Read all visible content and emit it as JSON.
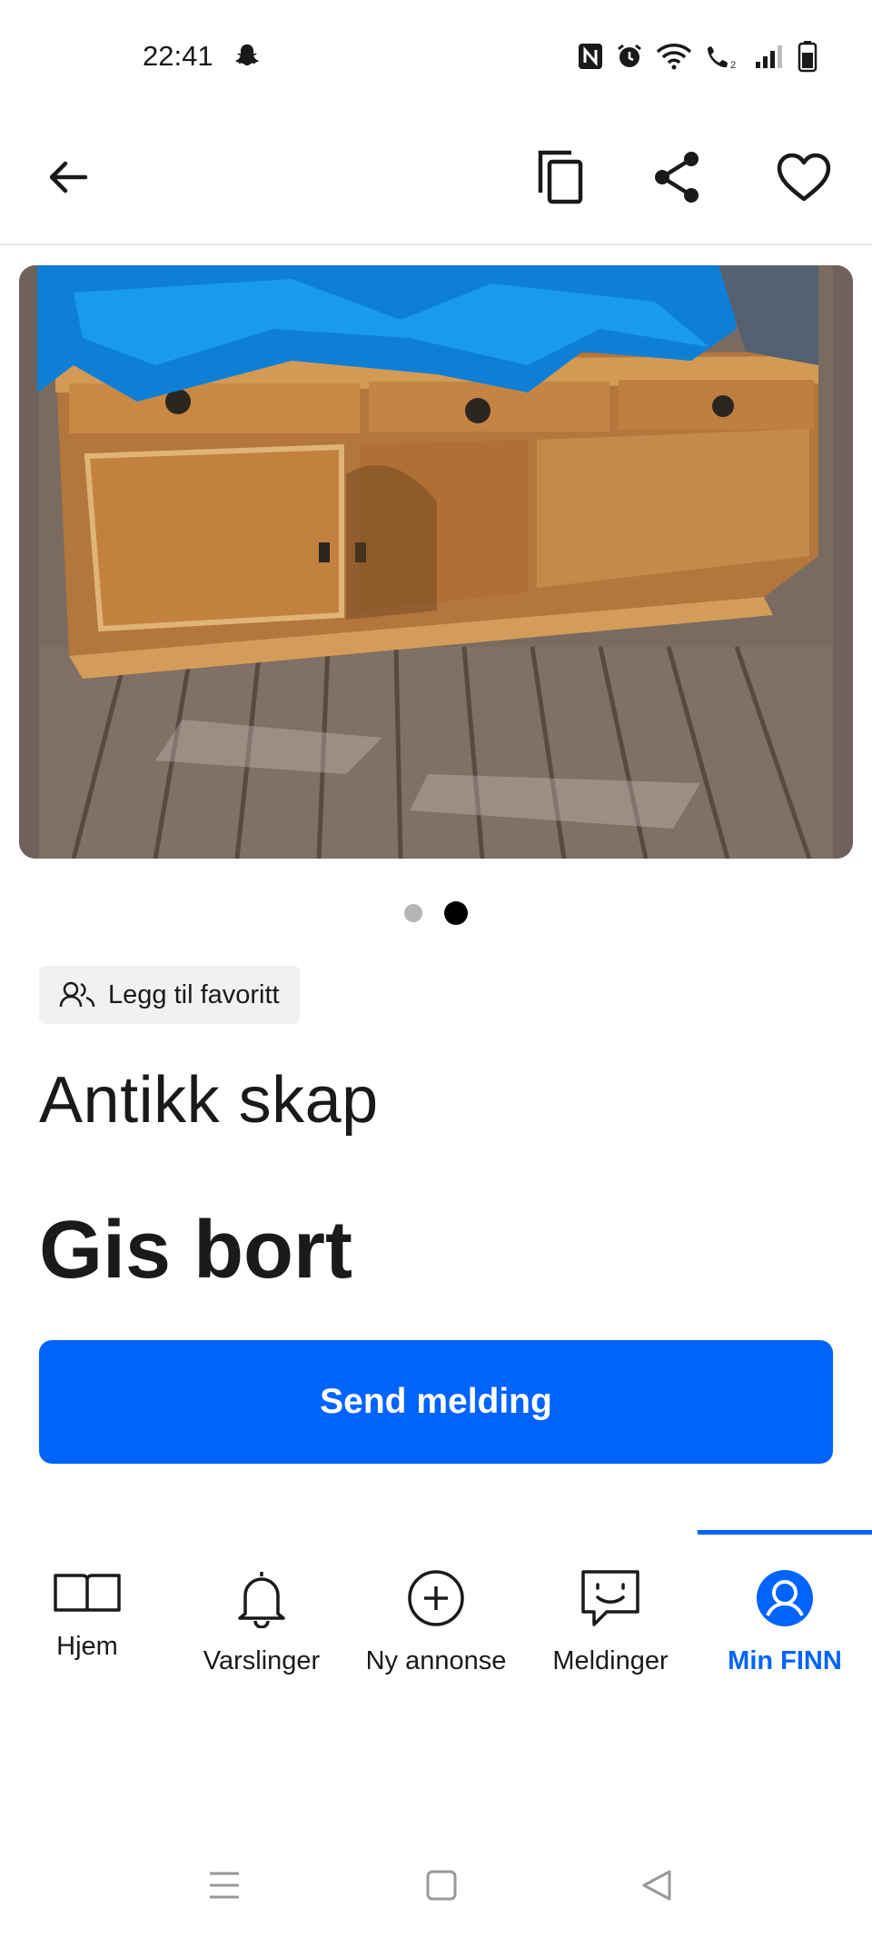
{
  "status_bar": {
    "time": "22:41",
    "icons": [
      "snapchat-icon",
      "nfc-icon",
      "alarm-icon",
      "wifi-icon",
      "wifi-call-icon",
      "signal-icon",
      "battery-icon"
    ]
  },
  "app_bar": {
    "icons": [
      "back-arrow-icon",
      "copy-icon",
      "share-icon",
      "heart-icon"
    ]
  },
  "carousel": {
    "page_count": 2,
    "active_index": 1
  },
  "listing": {
    "favorite_chip_label": "Legg til favoritt",
    "title": "Antikk skap",
    "price": "Gis bort",
    "send_button_label": "Send melding"
  },
  "bottom_nav": {
    "items": [
      {
        "label": "Hjem",
        "icon": "book-icon",
        "active": false
      },
      {
        "label": "Varslinger",
        "icon": "bell-icon",
        "active": false
      },
      {
        "label": "Ny annonse",
        "icon": "plus-circle-icon",
        "active": false
      },
      {
        "label": "Meldinger",
        "icon": "chat-icon",
        "active": false
      },
      {
        "label": "Min FINN",
        "icon": "profile-icon",
        "active": true
      }
    ]
  },
  "colors": {
    "accent": "#0063fb",
    "text": "#1a1a1a",
    "chip_bg": "#f1f1f2"
  }
}
